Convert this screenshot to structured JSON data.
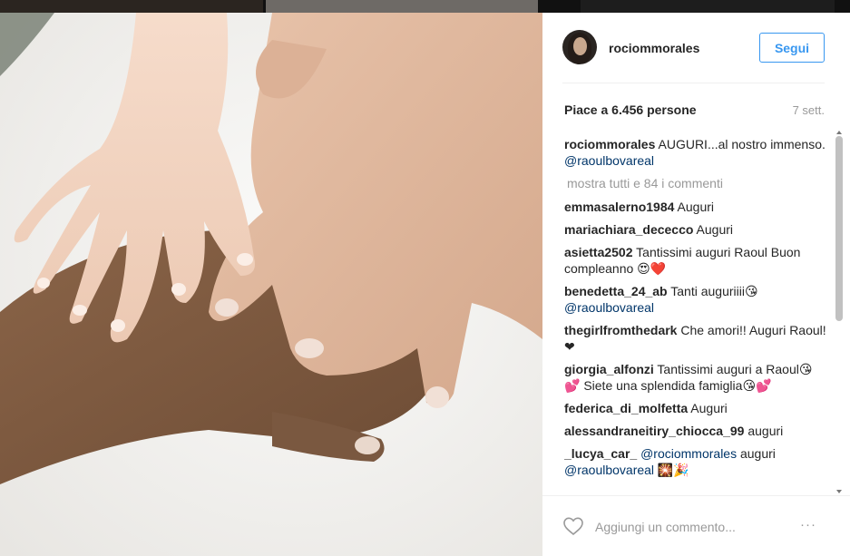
{
  "post": {
    "username": "rociommorales",
    "follow_label": "Segui",
    "likes_text": "Piace a 6.456 persone",
    "date": "7 sett.",
    "caption": {
      "user": "rociommorales",
      "text_before": " AUGURI...al nostro immenso. ",
      "mention": "@raoulbovareal"
    },
    "show_all_comments": "mostra tutti e 84 i commenti",
    "comments": [
      {
        "user": "emmasalerno1984",
        "text": " Auguri"
      },
      {
        "user": "mariachiara_dececco",
        "text": " Auguri"
      },
      {
        "user": "asietta2502",
        "text": " Tantissimi auguri Raoul Buon compleanno 😍❤️"
      },
      {
        "user": "benedetta_24_ab",
        "text": " Tanti auguriiii😘",
        "mention": "@raoulbovareal",
        "text_after": ""
      },
      {
        "user": "thegirlfromthedark",
        "text": " Che amori!! Auguri Raoul! ❤"
      },
      {
        "user": "giorgia_alfonzi",
        "text": " Tantissimi auguri a Raoul😘💕 Siete una splendida famiglia😘💕"
      },
      {
        "user": "federica_di_molfetta",
        "text": " Auguri"
      },
      {
        "user": "alessandraneitiry_chiocca_99",
        "text": " auguri"
      },
      {
        "user": "_lucya_car_",
        "text": " ",
        "mention": "@rociommorales",
        "text_after": " auguri ",
        "mention2": "@raoulbovareal",
        "text_after2": " 🎇🎉"
      }
    ],
    "add_comment_placeholder": "Aggiungi un commento...",
    "more_label": "···"
  },
  "icons": {
    "like": "heart-outline-icon",
    "options": "more-options-icon"
  },
  "colors": {
    "link_blue": "#3897f0",
    "mention": "#003569",
    "muted": "#999999"
  }
}
